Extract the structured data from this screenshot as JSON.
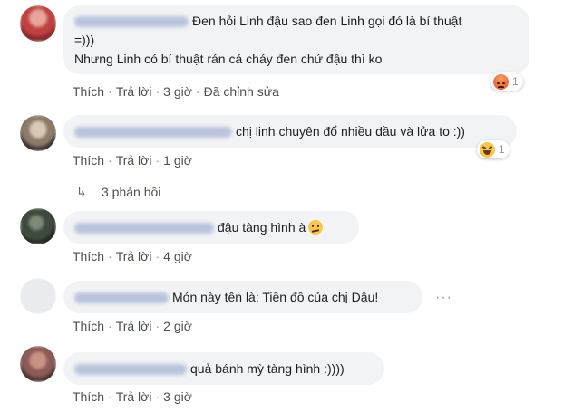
{
  "comments": [
    {
      "lines": [
        "Đen hỏi Linh đậu sao đen Linh gọi đó là bí thuật",
        "=)))",
        "Nhưng Linh có bí thuật rán cá cháy đen chứ đậu thì ko"
      ],
      "actions": {
        "like": "Thích",
        "reply": "Trả lời",
        "time": "3 giờ",
        "edited": "Đã chỉnh sửa"
      },
      "reaction": {
        "icon": "angry-reaction-icon",
        "count": "1"
      }
    },
    {
      "text": "chị linh chuyên đổ nhiều dầu và lửa to :))",
      "actions": {
        "like": "Thích",
        "reply": "Trả lời",
        "time": "1 giờ"
      },
      "reaction": {
        "icon": "haha-reaction-icon",
        "count": "1"
      },
      "replies_label": "3 phản hồi"
    },
    {
      "text": "đậu tàng hình à",
      "inline_icon": "confused-emoji-icon",
      "actions": {
        "like": "Thích",
        "reply": "Trả lời",
        "time": "4 giờ"
      }
    },
    {
      "text": "Món này tên là: Tiền đồ của chị Dậu!",
      "more": "···",
      "actions": {
        "like": "Thích",
        "reply": "Trả lời",
        "time": "2 giờ"
      }
    },
    {
      "text": "quả bánh mỳ tàng hình :))))",
      "actions": {
        "like": "Thích",
        "reply": "Trả lời",
        "time": "3 giờ"
      }
    }
  ],
  "separator": "·",
  "colors": {
    "bubble": "#f2f3f5",
    "link": "#4b4f56",
    "meta": "#606770",
    "name_blur": "#b9c3dc"
  }
}
